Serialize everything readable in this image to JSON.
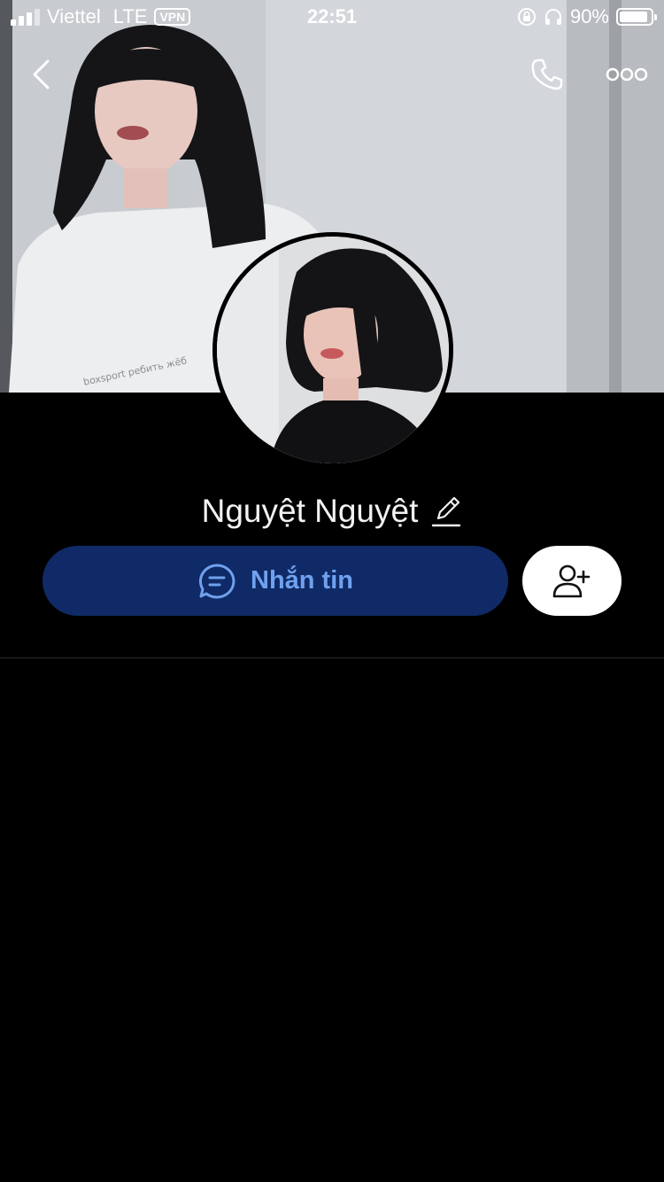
{
  "status_bar": {
    "carrier": "Viettel",
    "network": "LTE",
    "vpn": "VPN",
    "time": "22:51",
    "battery_percent": "90%",
    "battery_level": 0.9
  },
  "header": {
    "back_icon": "chevron-left-icon",
    "call_icon": "phone-icon",
    "more_icon": "more-horizontal-icon"
  },
  "profile": {
    "name": "Nguyệt Nguyệt",
    "edit_icon": "pencil-icon"
  },
  "actions": {
    "message_label": "Nhắn tin",
    "message_icon": "chat-bubble-icon",
    "add_friend_icon": "add-user-icon"
  },
  "colors": {
    "background": "#000000",
    "message_button_bg": "#0f2a66",
    "message_button_text": "#6fa1ee",
    "add_button_bg": "#ffffff"
  }
}
